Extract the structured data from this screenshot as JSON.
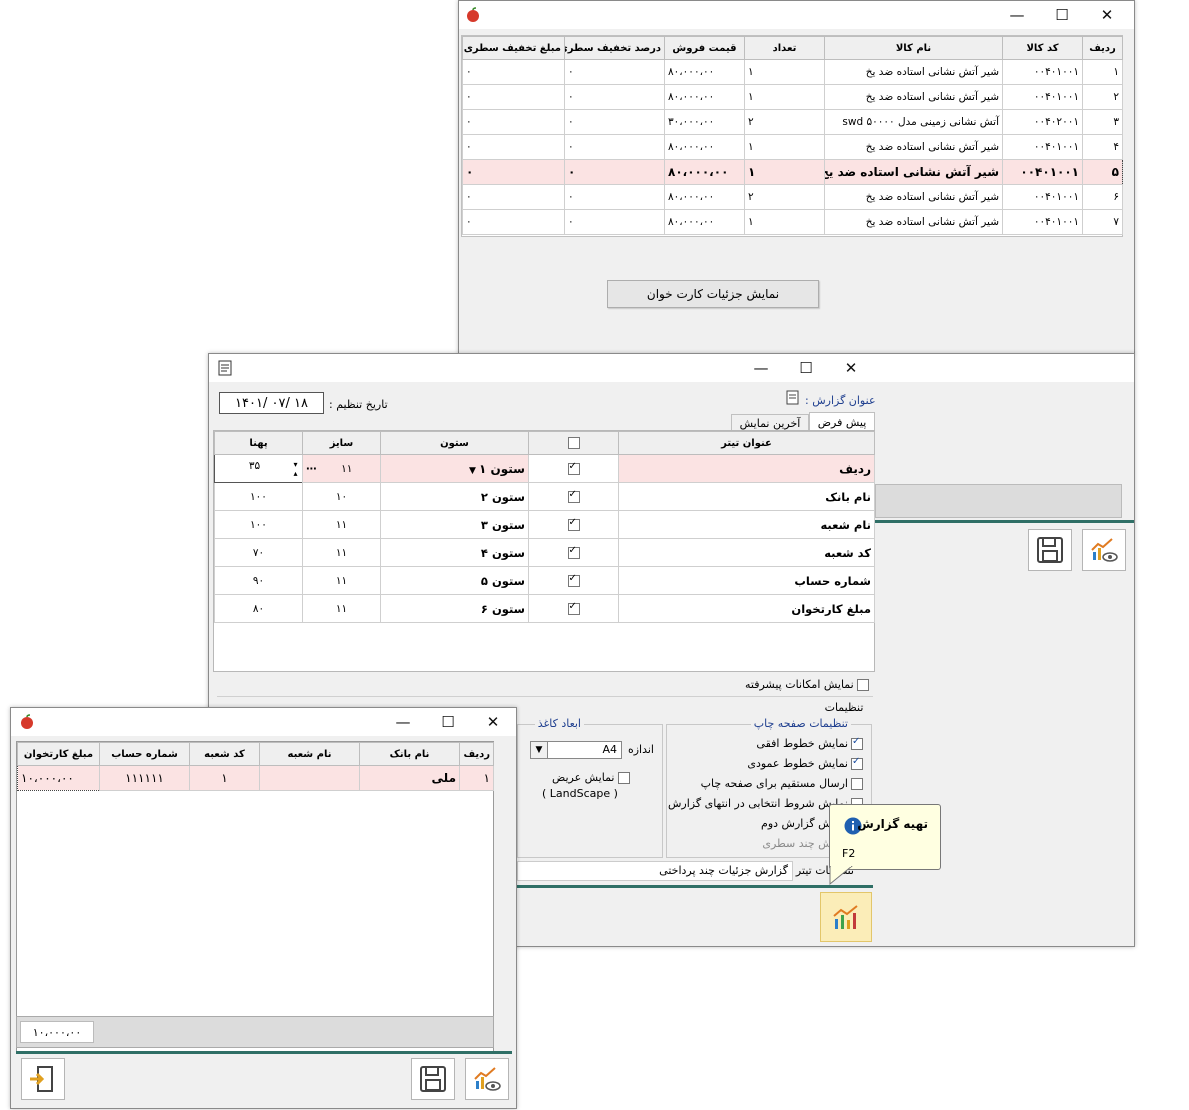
{
  "win1": {
    "items_table": {
      "columns": [
        "ردیف",
        "کد کالا",
        "نام کالا",
        "تعداد",
        "قیمت فروش",
        "درصد تخفیف سطری",
        "مبلغ تخفیف سطری"
      ],
      "rows": [
        [
          "۱",
          "۰۰۴۰۱۰۰۱",
          "شیر آتش نشانی استاده ضد یخ",
          "۱",
          "۸۰،۰۰۰،۰۰",
          "۰",
          "۰"
        ],
        [
          "۲",
          "۰۰۴۰۱۰۰۱",
          "شیر آتش نشانی استاده ضد یخ",
          "۱",
          "۸۰،۰۰۰،۰۰",
          "۰",
          "۰"
        ],
        [
          "۳",
          "۰۰۴۰۲۰۰۱",
          "آتش نشانی زمینی مدل ۵۰۰۰۰ swd",
          "۲",
          "۳۰،۰۰۰،۰۰",
          "۰",
          "۰"
        ],
        [
          "۴",
          "۰۰۴۰۱۰۰۱",
          "شیر آتش نشانی استاده ضد یخ",
          "۱",
          "۸۰،۰۰۰،۰۰",
          "۰",
          "۰"
        ],
        [
          "۵",
          "۰۰۴۰۱۰۰۱",
          "شیر آتش نشانی استاده ضد یخ",
          "۱",
          "۸۰،۰۰۰،۰۰",
          "۰",
          "۰"
        ],
        [
          "۶",
          "۰۰۴۰۱۰۰۱",
          "شیر آتش نشانی استاده ضد یخ",
          "۲",
          "۸۰،۰۰۰،۰۰",
          "۰",
          "۰"
        ],
        [
          "۷",
          "۰۰۴۰۱۰۰۱",
          "شیر آتش نشانی استاده ضد یخ",
          "۱",
          "۸۰،۰۰۰،۰۰",
          "۰",
          "۰"
        ]
      ]
    },
    "show_card_reader_button": "نمایش جزئیات کارت خوان"
  },
  "win2": {
    "report_title_label": "عنوان گزارش :",
    "date_label": "تاریخ تنظیم :",
    "date_value": "۱۴۰۱/ ۰۷/ ۱۸",
    "tabs": [
      "پیش فرض",
      "آخرین نمایش"
    ],
    "columns_table": {
      "headers": [
        "عنوان تیتر",
        "",
        "ستون",
        "سایز",
        "پهنا"
      ],
      "rows": [
        {
          "title": "ردیف",
          "col": "ستون ۱",
          "size": "۱۱",
          "width": "۳۵"
        },
        {
          "title": "نام بانک",
          "col": "ستون ۲",
          "size": "۱۰",
          "width": "۱۰۰"
        },
        {
          "title": "نام شعبه",
          "col": "ستون ۳",
          "size": "۱۱",
          "width": "۱۰۰"
        },
        {
          "title": "کد شعبه",
          "col": "ستون ۴",
          "size": "۱۱",
          "width": "۷۰"
        },
        {
          "title": "شماره حساب",
          "col": "ستون ۵",
          "size": "۱۱",
          "width": "۹۰"
        },
        {
          "title": "مبلغ کارتخوان",
          "col": "ستون ۶",
          "size": "۱۱",
          "width": "۸۰"
        }
      ]
    },
    "advanced_label": "نمایش امکانات پیشرفته",
    "settings_tab": "تنظیمات",
    "print_settings_title": "تنظیمات صفحه چاپ",
    "print_options": [
      {
        "label": "نمایش خطوط افقی",
        "checked": true
      },
      {
        "label": "نمایش خطوط عمودی",
        "checked": true
      },
      {
        "label": "ارسال مستقیم برای صفحه چاپ",
        "checked": false
      },
      {
        "label": "نمایش شروط انتخابی در انتهای گزارش",
        "checked": false
      },
      {
        "label": "نمایش گزارش دوم",
        "checked": false
      },
      {
        "label": "نمایش چند سطری",
        "checked": false
      }
    ],
    "paper_title": "ابعاد کاغذ",
    "paper_size_label": "اندازه",
    "paper_size_value": "A4",
    "landscape_label": "نمایش عریض",
    "landscape_sub": "( LandScape )",
    "header_settings_label": "تنظیمات تیتر :",
    "header_value": "گزارش جزئیات چند پرداختی"
  },
  "tooltip": {
    "title": "تهیه گزارش",
    "shortcut": "F2"
  },
  "win3": {
    "table": {
      "columns": [
        "ردیف",
        "نام بانک",
        "نام شعبه",
        "کد شعبه",
        "شماره حساب",
        "مبلغ کارتخوان"
      ],
      "rows": [
        [
          "۱",
          "ملی",
          "",
          "۱",
          "۱۱۱۱۱۱",
          "۱۰،۰۰۰،۰۰"
        ]
      ]
    },
    "total": "۱۰،۰۰۰،۰۰"
  }
}
